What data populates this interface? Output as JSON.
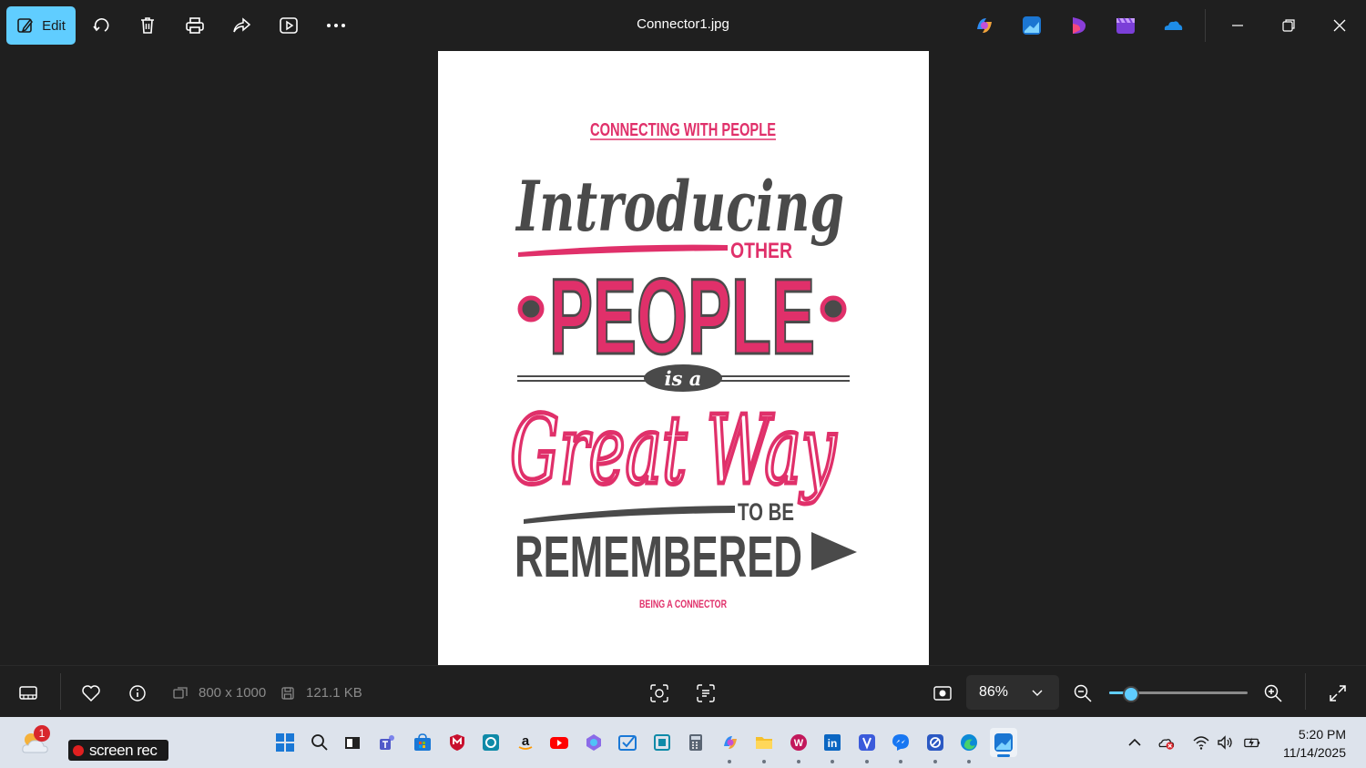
{
  "toolbar": {
    "edit_label": "Edit",
    "file_title": "Connector1.jpg"
  },
  "poster": {
    "top_line": "CONNECTING WITH PEOPLE",
    "introducing": "Introducing",
    "other": "OTHER",
    "people": "PEOPLE",
    "is_a": "is a",
    "great_way": "Great Way",
    "to_be": "TO BE",
    "remembered": "REMEMBERED",
    "bottom_line": "BEING A CONNECTOR",
    "colors": {
      "pink": "#e0306a",
      "gray": "#4a4a4a"
    }
  },
  "infobar": {
    "dimensions": "800 x 1000",
    "file_size": "121.1 KB",
    "zoom": "86%",
    "zoom_fraction": 0.16
  },
  "taskbar": {
    "weather_badge": "1",
    "screenrec_label": "screen rec",
    "time": "5:20 PM",
    "date": "11/14/2025"
  },
  "colors": {
    "accent": "#60cdff",
    "background": "#1f1f1f",
    "taskbar": "#dde3ec"
  }
}
